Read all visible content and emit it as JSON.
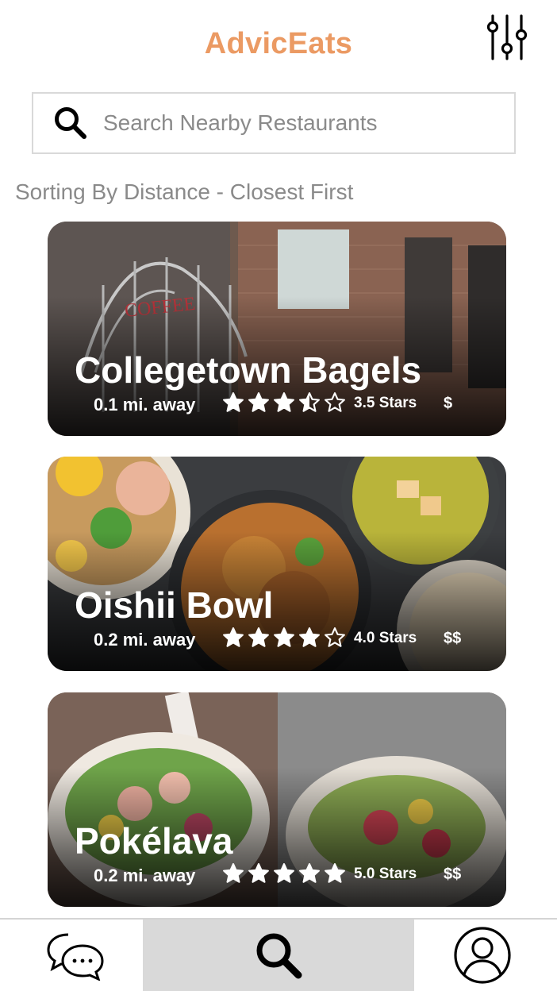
{
  "header": {
    "title": "AdvicEats",
    "title_color": "#eb9a63",
    "filter_icon": "sliders-icon"
  },
  "search": {
    "placeholder": "Search Nearby Restaurants",
    "value": "",
    "icon": "search-icon"
  },
  "sort_label": "Sorting By Distance - Closest First",
  "restaurants": [
    {
      "name": "Collegetown Bagels",
      "distance": "0.1 mi. away",
      "rating": 3.5,
      "rating_text": "3.5 Stars",
      "price": "$"
    },
    {
      "name": "Oishii Bowl",
      "distance": "0.2 mi. away",
      "rating": 4.0,
      "rating_text": "4.0 Stars",
      "price": "$$"
    },
    {
      "name": "Pokélava",
      "distance": "0.2 mi. away",
      "rating": 5.0,
      "rating_text": "5.0 Stars",
      "price": "$$"
    }
  ],
  "bottom_nav": {
    "items": [
      {
        "icon": "chat-bubbles-icon",
        "active": false
      },
      {
        "icon": "search-icon",
        "active": true
      },
      {
        "icon": "profile-icon",
        "active": false
      }
    ],
    "active_background": "#d9d9d9"
  }
}
